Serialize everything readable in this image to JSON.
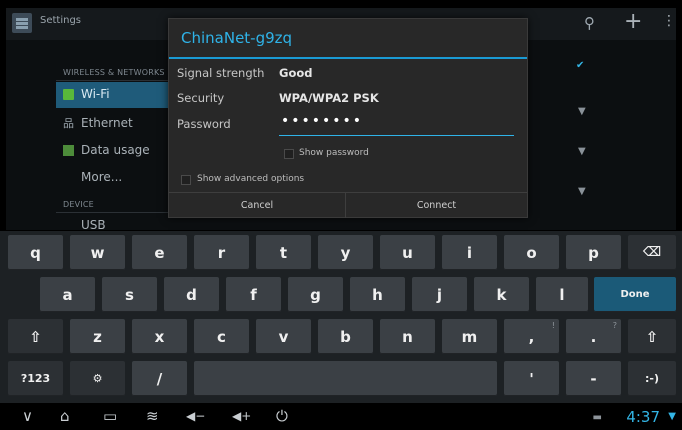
{
  "app": {
    "title": "Settings"
  },
  "sidebar": {
    "categories": {
      "wireless": "WIRELESS & NETWORKS",
      "device": "DEVICE",
      "device_partial_item": "USB"
    },
    "items": [
      {
        "label": "Wi-Fi",
        "selected": true
      },
      {
        "label": "Ethernet"
      },
      {
        "label": "Data usage"
      },
      {
        "label": "More..."
      }
    ]
  },
  "dialog": {
    "title": "ChinaNet-g9zq",
    "signal_label": "Signal strength",
    "signal_value": "Good",
    "security_label": "Security",
    "security_value": "WPA/WPA2 PSK",
    "password_label": "Password",
    "password_value": "••••••••",
    "show_password": "Show password",
    "advanced": "Show advanced options",
    "cancel": "Cancel",
    "connect": "Connect"
  },
  "keyboard": {
    "row1": [
      "q",
      "w",
      "e",
      "r",
      "t",
      "y",
      "u",
      "i",
      "o",
      "p"
    ],
    "row2": [
      "a",
      "s",
      "d",
      "f",
      "g",
      "h",
      "j",
      "k",
      "l"
    ],
    "row3": [
      "z",
      "x",
      "c",
      "v",
      "b",
      "n",
      "m",
      ",",
      "."
    ],
    "done": "Done",
    "sym": "?123",
    "emoticon": ":-)",
    "slash": "/",
    "comma_sup": "!",
    "period_sup": "?"
  },
  "navbar": {
    "clock": "4:37"
  },
  "colors": {
    "accent": "#33b5e5",
    "selected": "#1f5b7a"
  }
}
